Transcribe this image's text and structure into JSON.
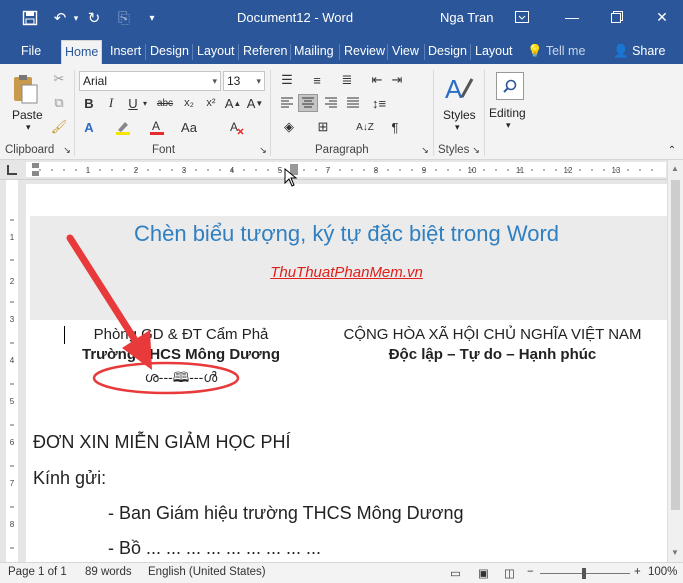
{
  "titlebar": {
    "document_title": "Document12  -  Word",
    "user_name": "Nga Tran",
    "icons": [
      "save-icon",
      "undo-icon",
      "redo-icon",
      "touch-mode-icon",
      "customize-icon",
      "ribbon-display-icon",
      "minimize-icon",
      "restore-icon",
      "close-icon"
    ]
  },
  "tabs": [
    {
      "label": "File"
    },
    {
      "label": "Home",
      "active": true
    },
    {
      "label": "Insert"
    },
    {
      "label": "Design"
    },
    {
      "label": "Layout"
    },
    {
      "label": "Referen"
    },
    {
      "label": "Mailing"
    },
    {
      "label": "Review"
    },
    {
      "label": "View"
    },
    {
      "label": "Design"
    },
    {
      "label": "Layout"
    }
  ],
  "tell_me": "Tell me",
  "share": "Share",
  "ribbon": {
    "paste_label": "Paste",
    "font_name": "Arial",
    "font_size": "13",
    "styles_label": "Styles",
    "editing_label": "Editing",
    "groups": {
      "clipboard": "Clipboard",
      "font": "Font",
      "paragraph": "Paragraph",
      "styles": "Styles"
    }
  },
  "document": {
    "heading": "Chèn biểu tượng, ký tự đặc biệt trong Word",
    "watermark": "ThuThuatPhanMem.vn",
    "left_org_line1": "Phòng GD & ĐT Cẩm Phả",
    "left_org_line2": "Trường THCS Mông Dương",
    "ornament": "ശ---🕮---ൾ",
    "right_line1": "CỘNG HÒA XÃ HỘI CHỦ NGHĨA VIỆT NAM",
    "right_line2": "Độc lập – Tự do – Hạnh phúc",
    "form_title": "ĐƠN XIN MIỄN GIẢM HỌC PHÍ",
    "greeting": "Kính gửi:",
    "recipient1": "- Ban Giám hiệu trường THCS Mông Dương",
    "recipient2_partial": "- Bồ ... ... ... ... ... ... ... ... ..."
  },
  "status": {
    "page": "Page 1 of 1",
    "words": "89 words",
    "language": "English (United States)",
    "zoom": "100%"
  },
  "colors": {
    "accent": "#2b579a",
    "heading": "#2f7fc1",
    "watermark": "#e0201c",
    "arrow": "#e83a3a"
  }
}
